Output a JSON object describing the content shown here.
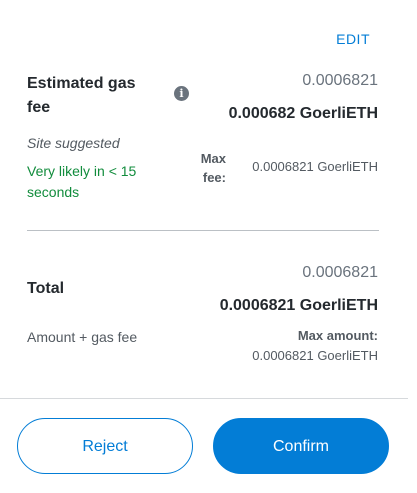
{
  "edit": {
    "label": "EDIT"
  },
  "gas": {
    "title": "Estimated gas fee",
    "info_icon": "info-icon",
    "secondary_value": "0.0006821",
    "primary_value": "0.000682 GoerliETH",
    "site_suggested": "Site suggested",
    "likely_text": "Very likely in < 15 seconds",
    "max_fee_label": "Max fee:",
    "max_fee_value": "0.0006821 GoerliETH"
  },
  "total": {
    "title": "Total",
    "secondary_value": "0.0006821",
    "primary_value": "0.0006821 GoerliETH",
    "subtitle": "Amount + gas fee",
    "max_amount_label": "Max amount:",
    "max_amount_value": "0.0006821 GoerliETH"
  },
  "footer": {
    "reject_label": "Reject",
    "confirm_label": "Confirm"
  },
  "colors": {
    "accent": "#037dd6",
    "success": "#118c3c",
    "text": "#24292e",
    "muted": "#6a737d"
  }
}
